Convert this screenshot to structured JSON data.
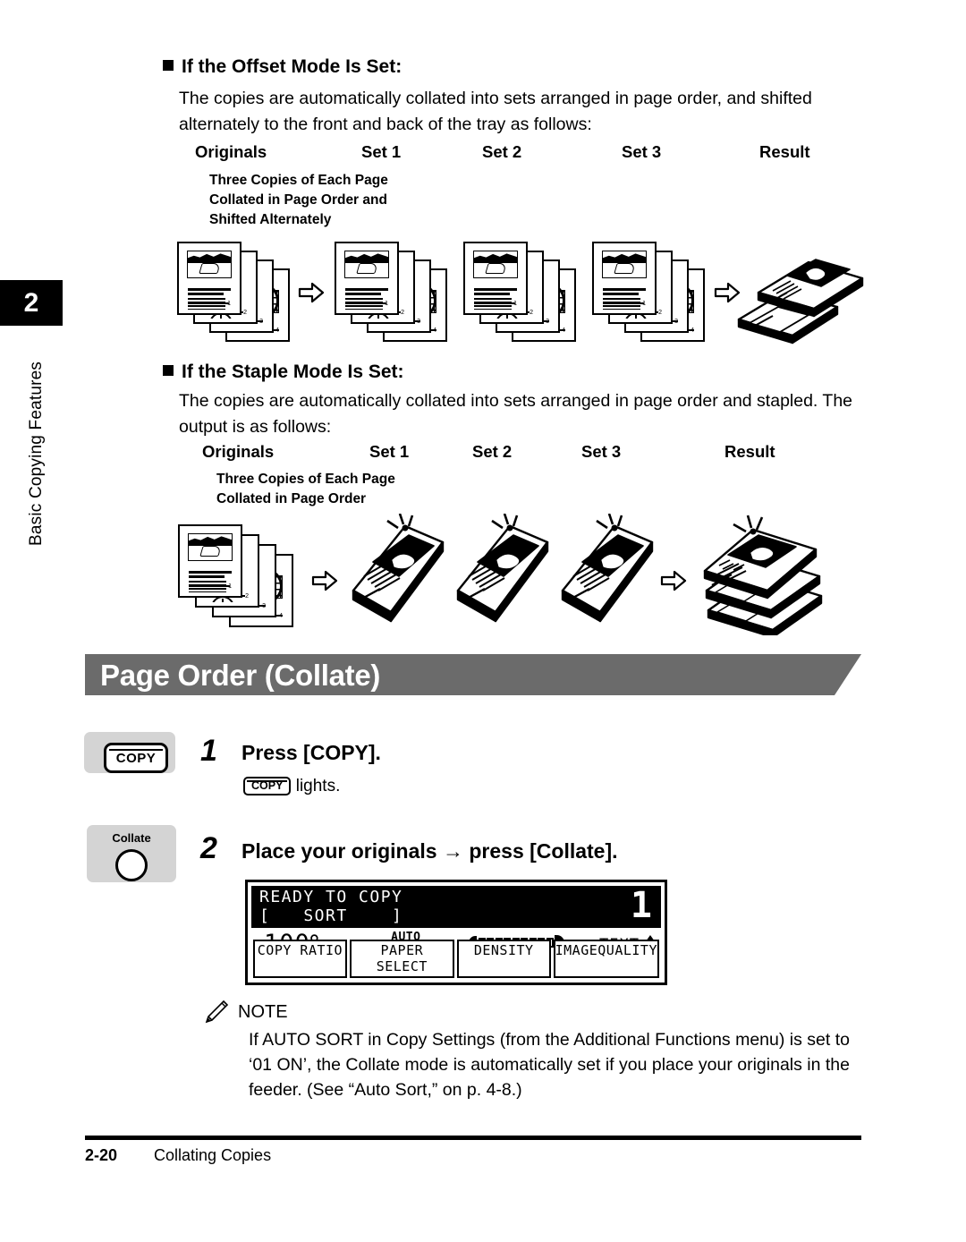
{
  "chapter": {
    "number": "2",
    "title": "Basic Copying Features"
  },
  "sections": [
    {
      "heading": "If the Offset Mode Is Set:",
      "body": "The copies are automatically collated into sets arranged in page order, and shifted alternately to the front and back of the tray as follows:",
      "columns": [
        "Originals",
        "Set 1",
        "Set 2",
        "Set 3",
        "Result"
      ],
      "caption": "Three Copies of Each Page\nCollated in Page Order and\nShifted Alternately"
    },
    {
      "heading": "If the Staple Mode Is Set:",
      "body": "The copies are automatically collated into sets arranged in page order and stapled. The output is as follows:",
      "columns": [
        "Originals",
        "Set 1",
        "Set 2",
        "Set 3",
        "Result"
      ],
      "caption": "Three Copies of Each Page\nCollated in Page Order"
    }
  ],
  "page_numbers_on_sheets": [
    "1",
    "2",
    "3",
    "4"
  ],
  "banner": {
    "title": "Page Order (Collate)",
    "color": "#6b6b6b"
  },
  "steps": [
    {
      "number": "1",
      "title": "Press [COPY].",
      "key_label": "COPY",
      "sub_key_label": "COPY",
      "sub_text": "lights."
    },
    {
      "number": "2",
      "title": "Place your originals → press [Collate].",
      "key_label": "Collate"
    }
  ],
  "lcd": {
    "line1": "READY TO COPY",
    "line2": "[   SORT    ]",
    "count": "1",
    "ratio": "100%",
    "paper_line1": "AUTO",
    "paper_line2": "PAPER",
    "image_quality_value": "TEXT",
    "density_segments": [
      0,
      0,
      0,
      0,
      1,
      0,
      0,
      0,
      0
    ],
    "buttons": [
      "COPY RATIO",
      "PAPER SELECT",
      "DENSITY",
      "IMAGEQUALITY"
    ]
  },
  "note": {
    "label": "NOTE",
    "body": "If AUTO SORT in Copy Settings (from the Additional Functions menu) is set to ‘01 ON’, the Collate mode is automatically set if you place your originals in the feeder. (See “Auto Sort,” on p. 4-8.)"
  },
  "footer": {
    "page": "2-20",
    "section": "Collating Copies"
  }
}
